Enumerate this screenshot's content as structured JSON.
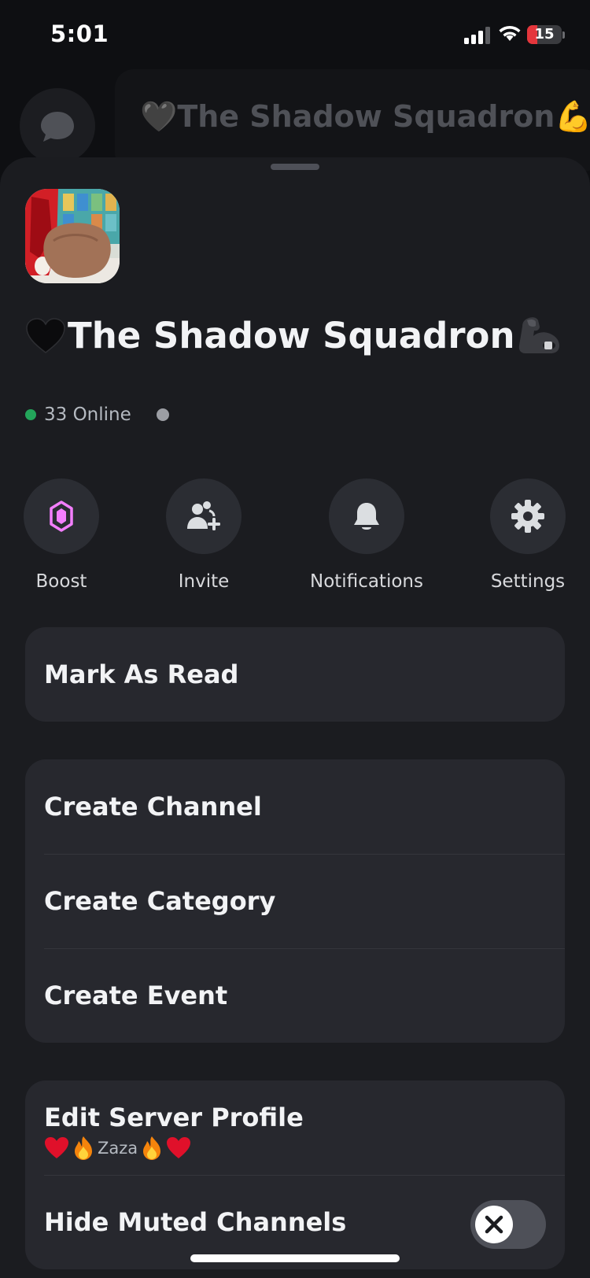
{
  "status_bar": {
    "time": "5:01",
    "battery_level": "15",
    "battery_color": "#e4363c",
    "signal_icon": "cellular-signal-icon",
    "wifi_icon": "wifi-icon"
  },
  "background": {
    "server_name": "🖤The Shadow Squadron💪",
    "dm_icon": "chat-bubble-icon"
  },
  "server": {
    "name": "The Shadow Squadron",
    "name_prefix_emoji": "black-heart-icon",
    "name_suffix_emoji": "flexed-biceps-icon",
    "online_text": "33 Online"
  },
  "actions": [
    {
      "label": "Boost",
      "icon": "nitro-boost-icon",
      "accent": "#f47fff"
    },
    {
      "label": "Invite",
      "icon": "add-person-icon"
    },
    {
      "label": "Notifications",
      "icon": "bell-icon"
    },
    {
      "label": "Settings",
      "icon": "gear-icon"
    }
  ],
  "menu": {
    "mark_as_read": "Mark As Read",
    "create_channel": "Create Channel",
    "create_category": "Create Category",
    "create_event": "Create Event",
    "edit_server_profile": "Edit Server Profile",
    "profile_nickname": "Zaza",
    "hide_muted_channels": "Hide Muted Channels",
    "hide_muted_enabled": false
  },
  "colors": {
    "online_green": "#23a55a",
    "sheet_bg": "#1b1c20",
    "card_bg": "#27282e"
  }
}
